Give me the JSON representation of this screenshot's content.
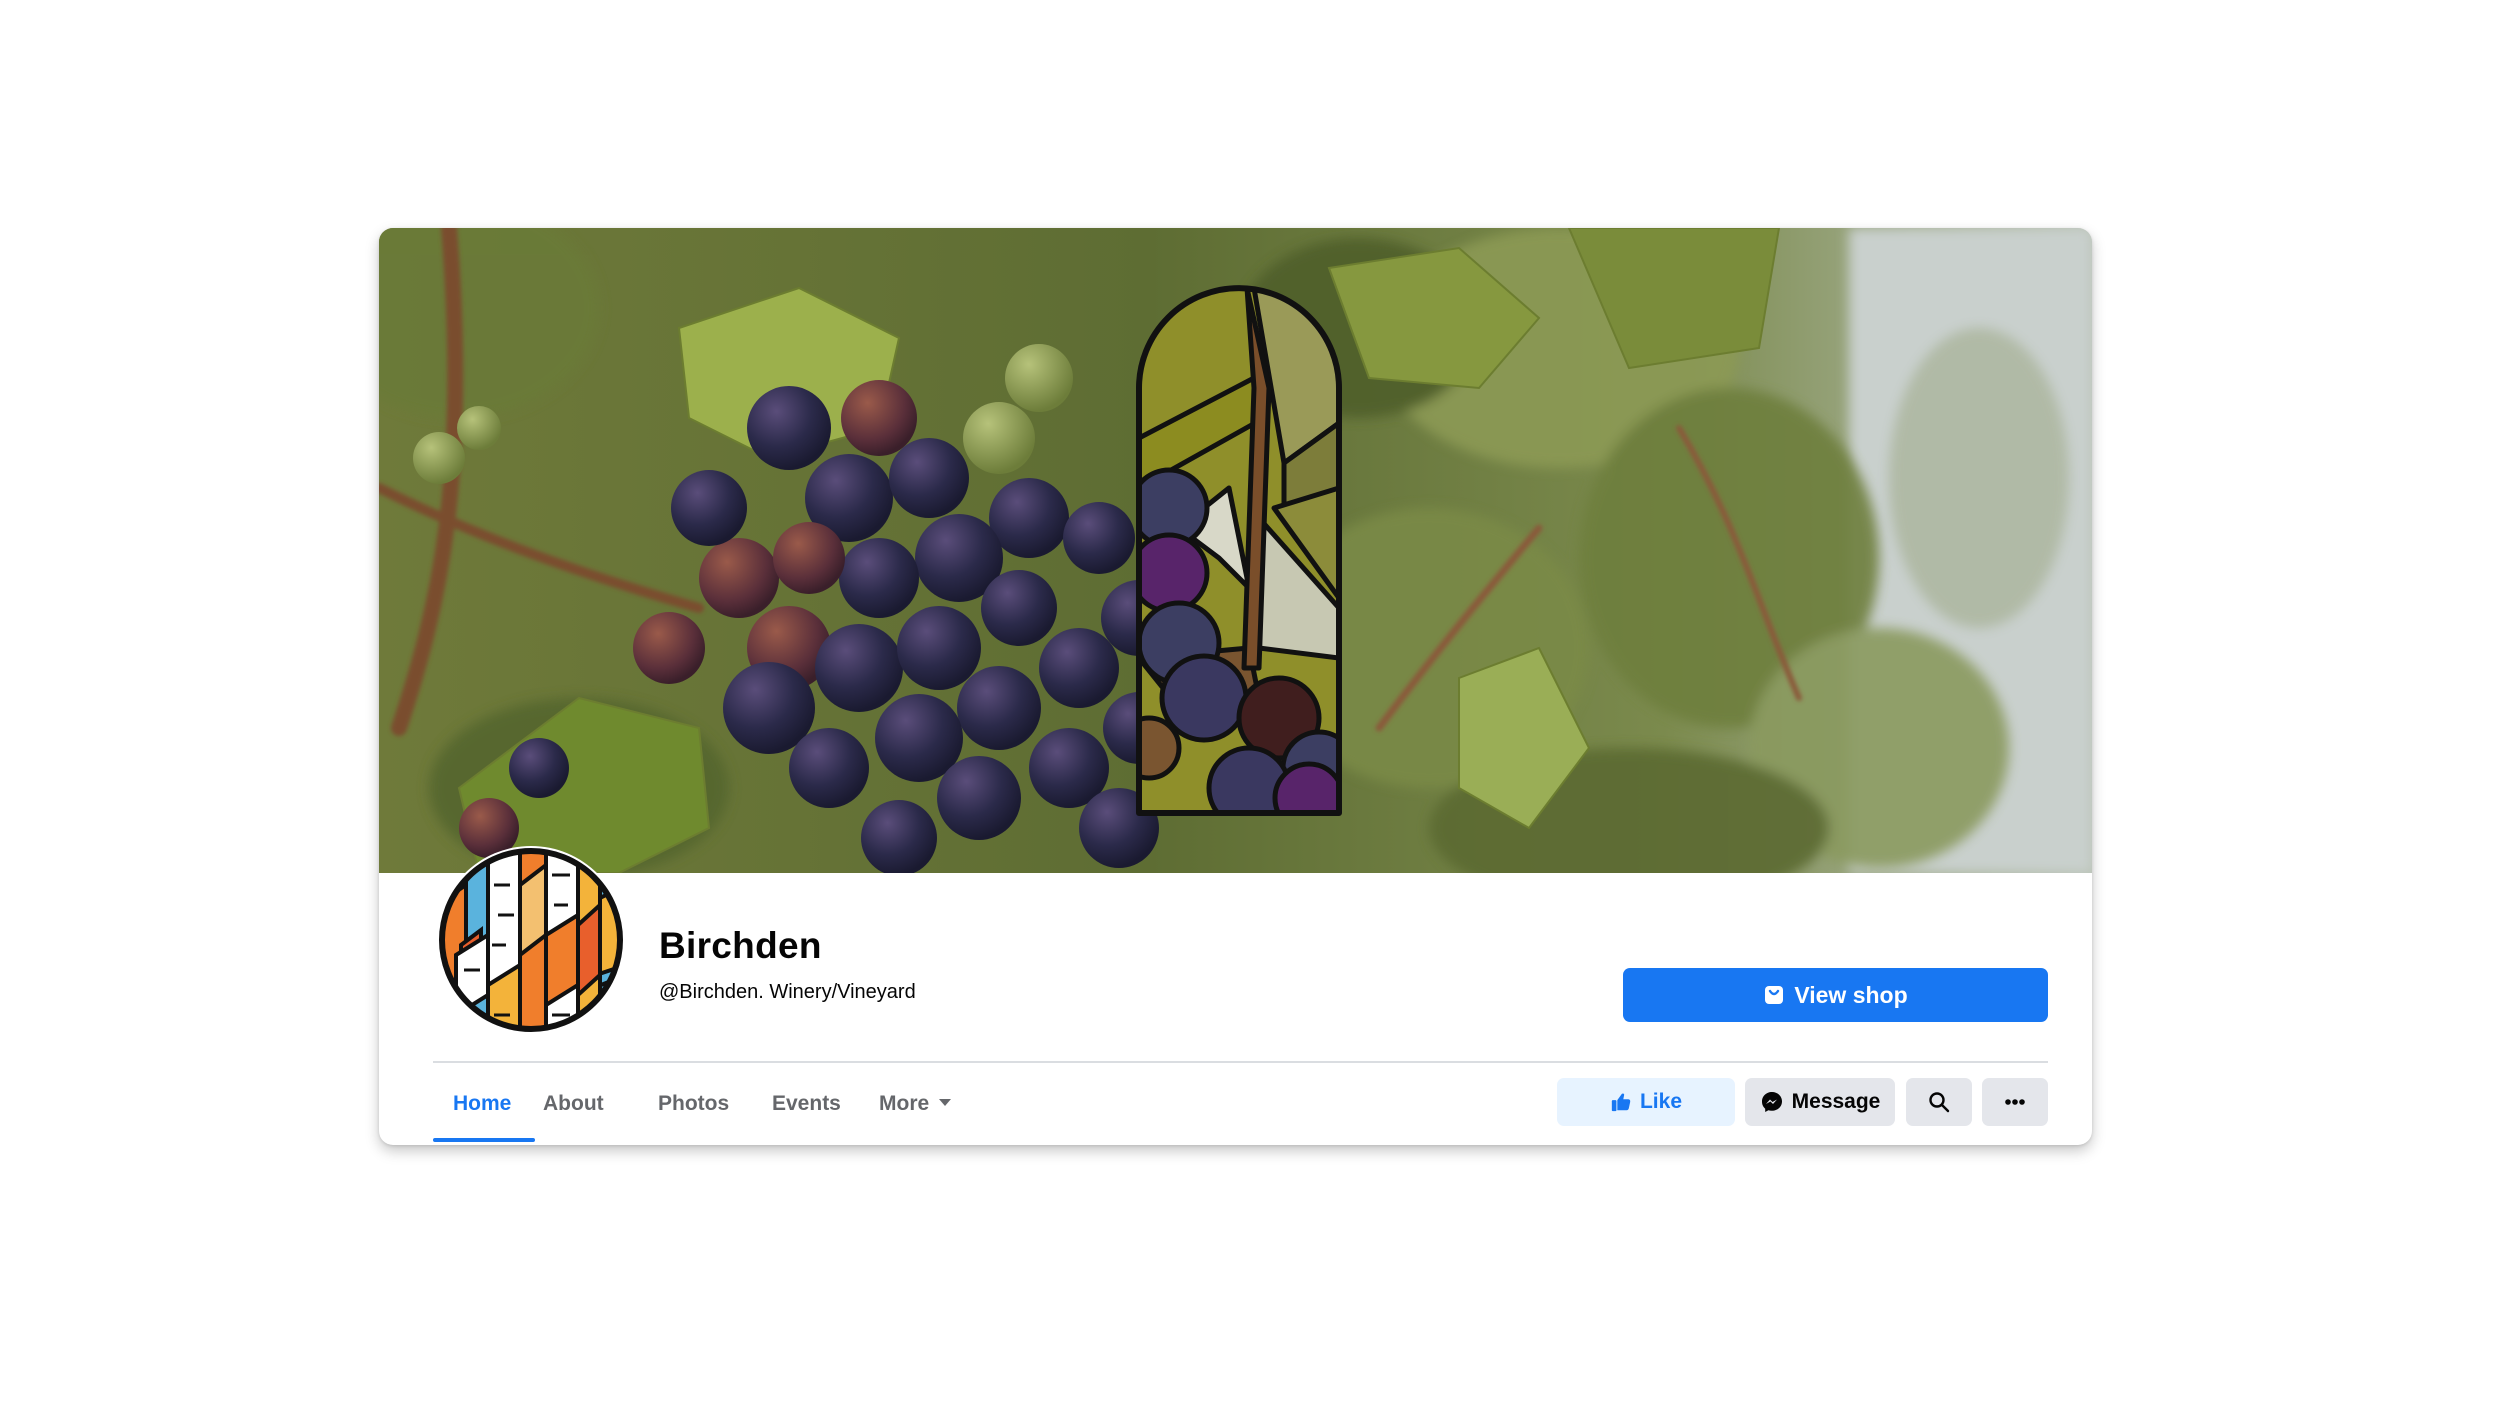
{
  "page": {
    "name": "Birchden",
    "handle": "@Birchden. Winery/Vineyard"
  },
  "buttons": {
    "view_shop": "View shop",
    "like": "Like",
    "message": "Message"
  },
  "tabs": [
    {
      "label": "Home",
      "active": true
    },
    {
      "label": "About",
      "active": false
    },
    {
      "label": "Photos",
      "active": false
    },
    {
      "label": "Events",
      "active": false
    },
    {
      "label": "More",
      "active": false
    }
  ],
  "icons": {
    "view_shop": "shop-bag-icon",
    "like": "thumbs-up-icon",
    "message": "messenger-icon",
    "search": "search-icon",
    "more": "more-dots-icon",
    "tab_more": "caret-down-icon"
  },
  "colors": {
    "accent": "#1877f2",
    "like_bg": "#e7f3ff",
    "secondary_bg": "#e4e6eb",
    "tab_inactive": "#65676b"
  }
}
